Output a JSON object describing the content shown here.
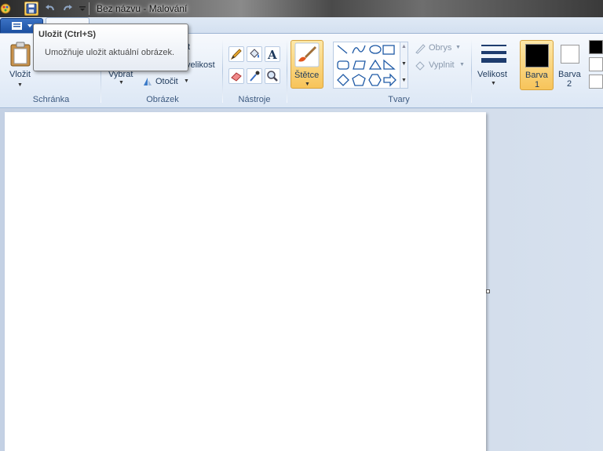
{
  "window": {
    "title": "Bez názvu - Malování"
  },
  "tabs": {
    "home": ""
  },
  "ribbon": {
    "clipboard": {
      "paste_label": "Vložit",
      "group_label": "Schránka"
    },
    "image": {
      "select_label": "Vybrat",
      "crop_partial": "t",
      "resize_partial": "velikost",
      "rotate_label": "Otočit",
      "group_label": "Obrázek"
    },
    "tools": {
      "group_label": "Nástroje"
    },
    "brushes": {
      "label": "Štětce"
    },
    "shapes": {
      "outline_label": "Obrys",
      "fill_label": "Vyplnit",
      "group_label": "Tvary"
    },
    "size": {
      "label": "Velikost"
    },
    "colors": {
      "color1_line1": "Barva",
      "color1_line2": "1",
      "color2_line1": "Barva",
      "color2_line2": "2",
      "color1_value": "#000000",
      "color2_value": "#ffffff"
    }
  },
  "tooltip": {
    "title": "Uložit (Ctrl+S)",
    "description": "Umožňuje uložit aktuální obrázek."
  },
  "icons": [
    "paint-app-icon",
    "save-icon",
    "undo-icon",
    "redo-icon",
    "customize-icon",
    "paste-icon",
    "pencil-icon",
    "fill-icon",
    "text-icon",
    "eraser-icon",
    "color-picker-icon",
    "magnifier-icon",
    "brush-icon",
    "rotate-icon"
  ]
}
